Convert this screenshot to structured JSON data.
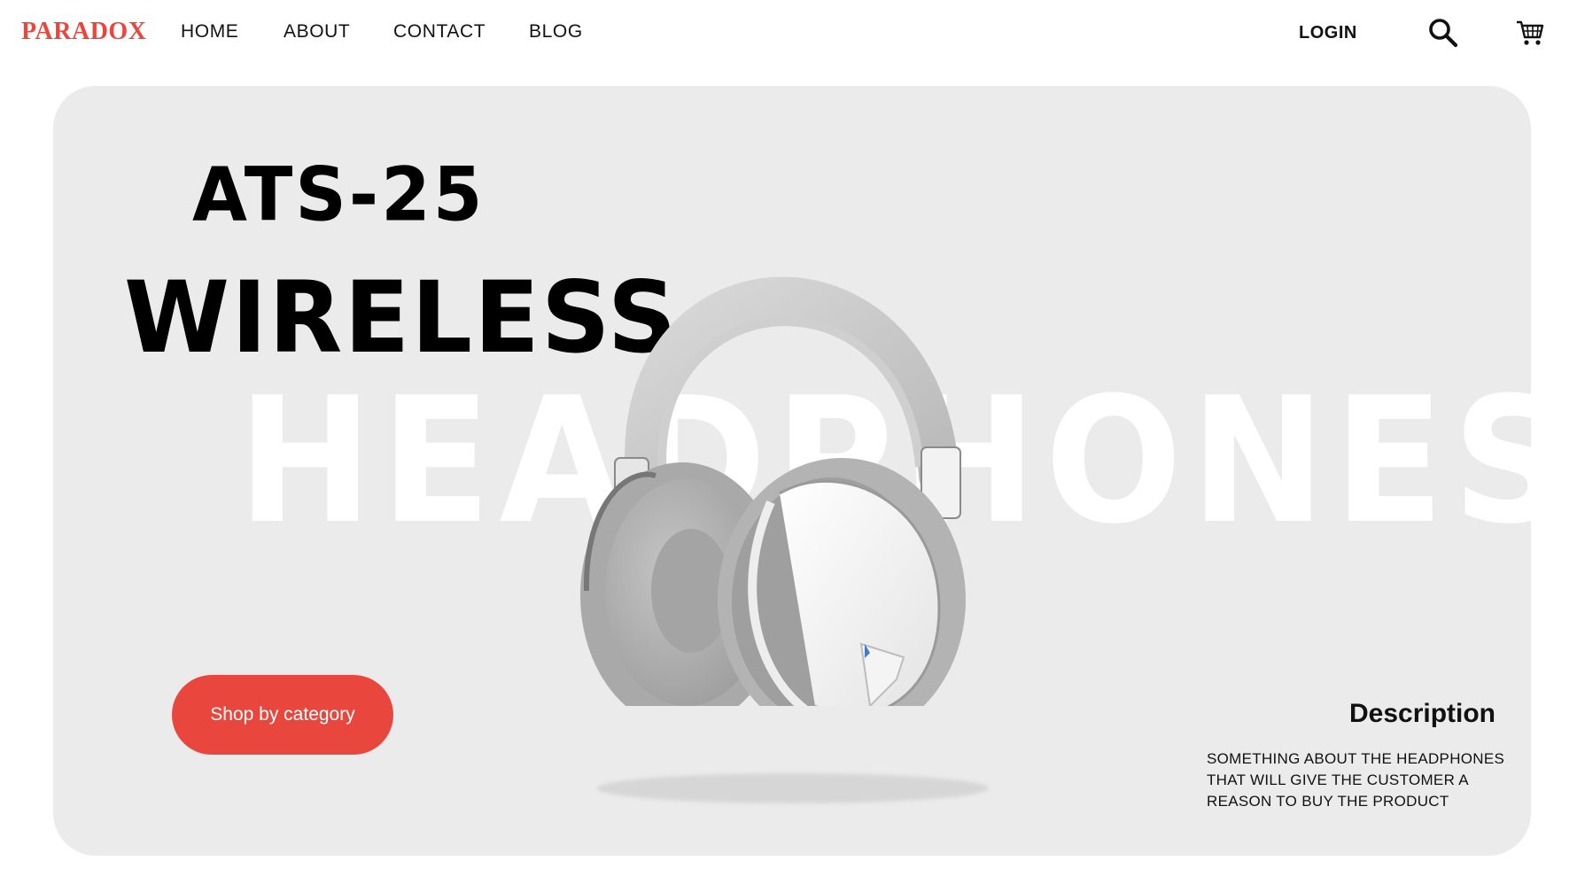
{
  "brand": {
    "name": "PARADOX",
    "color": "#e9473e"
  },
  "nav": {
    "links": [
      "HOME",
      "ABOUT",
      "CONTACT",
      "BLOG"
    ],
    "login_label": "LOGIN",
    "icons": [
      "search-icon",
      "cart-icon"
    ]
  },
  "hero": {
    "model": "ATS-25",
    "headline": "WIRELESS",
    "background_word": "HEADPHONES",
    "background_color": "#ebebeb",
    "cta_label": "Shop by category",
    "cta_color": "#e9473e",
    "product_image": "white over-ear headphones"
  },
  "description": {
    "title": "Description",
    "body": "SOMETHING ABOUT THE HEADPHONES THAT WILL GIVE THE CUSTOMER A REASON TO BUY THE PRODUCT"
  }
}
